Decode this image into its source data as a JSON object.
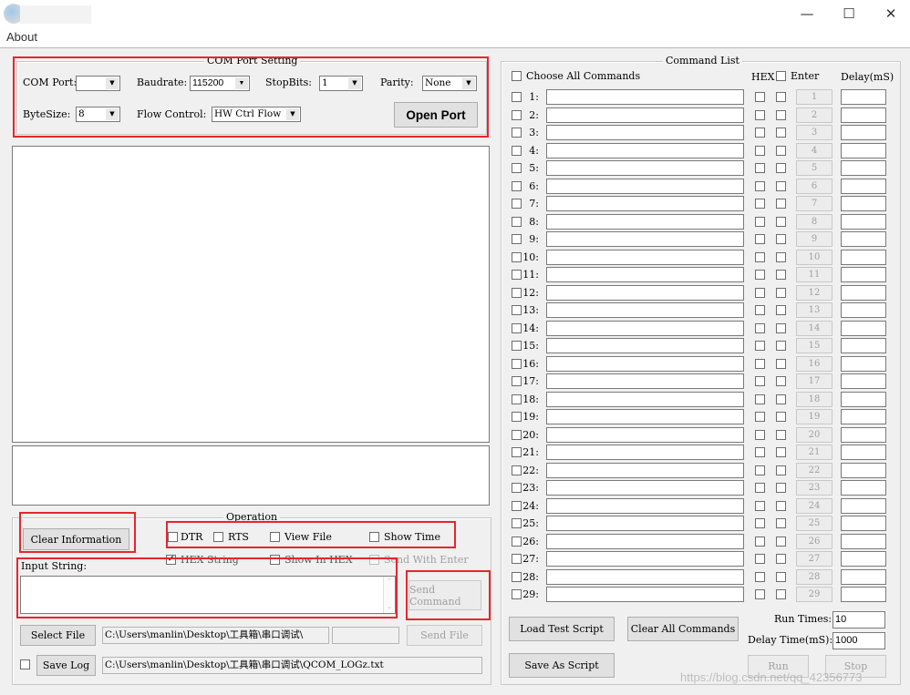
{
  "window": {
    "minimize": "—",
    "maximize": "☐",
    "close": "✕"
  },
  "menu": {
    "about": "About"
  },
  "com_port_setting": {
    "title": "COM Port Setting",
    "com_port_label": "COM Port:",
    "com_port_value": "",
    "baudrate_label": "Baudrate:",
    "baudrate_value": "115200",
    "stopbits_label": "StopBits:",
    "stopbits_value": "1",
    "parity_label": "Parity:",
    "parity_value": "None",
    "bytesize_label": "ByteSize:",
    "bytesize_value": "8",
    "flow_control_label": "Flow Control:",
    "flow_control_value": "HW Ctrl Flow",
    "open_port": "Open Port"
  },
  "operation": {
    "title": "Operation",
    "clear_information": "Clear Information",
    "dtr": "DTR",
    "rts": "RTS",
    "view_file": "View File",
    "show_time": "Show Time",
    "hex_string": "HEX String",
    "show_in_hex": "Show In HEX",
    "send_with_enter": "Send With Enter",
    "input_string_label": "Input String:",
    "send_command": "Send Command",
    "select_file": "Select File",
    "file_path": "C:\\Users\\manlin\\Desktop\\工具箱\\串口调试\\",
    "send_file": "Send File",
    "save_log": "Save Log",
    "log_path": "C:\\Users\\manlin\\Desktop\\工具箱\\串口调试\\QCOM_LOGz.txt"
  },
  "command_list": {
    "title": "Command List",
    "choose_all": "Choose All Commands",
    "hex_header": "HEX",
    "enter_header": "Enter",
    "delay_header": "Delay(mS)",
    "rows": [
      "1",
      "2",
      "3",
      "4",
      "5",
      "6",
      "7",
      "8",
      "9",
      "10",
      "11",
      "12",
      "13",
      "14",
      "15",
      "16",
      "17",
      "18",
      "19",
      "20",
      "21",
      "22",
      "23",
      "24",
      "25",
      "26",
      "27",
      "28",
      "29"
    ],
    "load_test_script": "Load Test Script",
    "clear_all_commands": "Clear All Commands",
    "save_as_script": "Save As Script",
    "run_times_label": "Run Times:",
    "run_times_value": "10",
    "delay_time_label": "Delay Time(mS):",
    "delay_time_value": "1000",
    "run": "Run",
    "stop": "Stop"
  },
  "watermark": "https://blog.csdn.net/qq_42356773"
}
